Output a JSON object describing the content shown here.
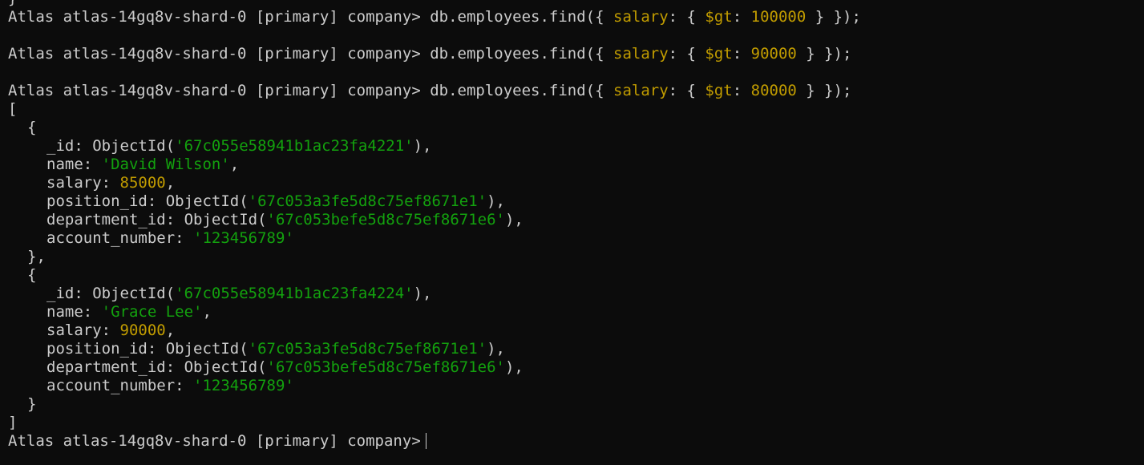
{
  "prompt": "Atlas atlas-14gq8v-shard-0 [primary] company>",
  "top_fragment": "}",
  "commands": [
    {
      "pre": "db.employees.find({ ",
      "key": "salary",
      "mid": ": { ",
      "op": "$gt",
      "colon": ": ",
      "value": "100000",
      "post": " } });"
    },
    {
      "pre": "db.employees.find({ ",
      "key": "salary",
      "mid": ": { ",
      "op": "$gt",
      "colon": ": ",
      "value": "90000",
      "post": " } });"
    },
    {
      "pre": "db.employees.find({ ",
      "key": "salary",
      "mid": ": { ",
      "op": "$gt",
      "colon": ": ",
      "value": "80000",
      "post": " } });"
    }
  ],
  "result": {
    "open_bracket": "[",
    "close_bracket": "]",
    "open_brace": "{",
    "close_brace_comma": "},",
    "close_brace": "}",
    "labels": {
      "id": "_id: ",
      "object_id_open": "ObjectId(",
      "object_id_close": "),",
      "name": "name: ",
      "salary": "salary: ",
      "position_id": "position_id: ",
      "department_id": "department_id: ",
      "account_number": "account_number: ",
      "comma": ","
    },
    "documents": [
      {
        "id": "'67c055e58941b1ac23fa4221'",
        "name": "'David Wilson'",
        "salary": "85000",
        "position_id": "'67c053a3fe5d8c75ef8671e1'",
        "department_id": "'67c053befe5d8c75ef8671e6'",
        "account_number": "'123456789'"
      },
      {
        "id": "'67c055e58941b1ac23fa4224'",
        "name": "'Grace Lee'",
        "salary": "90000",
        "position_id": "'67c053a3fe5d8c75ef8671e1'",
        "department_id": "'67c053befe5d8c75ef8671e6'",
        "account_number": "'123456789'"
      }
    ]
  },
  "colors": {
    "background": "#0c0c0c",
    "text": "#cccccc",
    "key": "#c19c00",
    "string": "#13a10e"
  }
}
